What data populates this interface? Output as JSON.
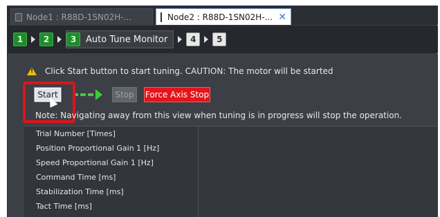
{
  "tabs": [
    {
      "label": "Node1 : R88D-1SN02H-...",
      "active": false
    },
    {
      "label": "Node2 : R88D-1SN02H-...",
      "active": true
    }
  ],
  "tab_close_glyph": "✕",
  "steps": {
    "items": [
      "1",
      "2",
      "3",
      "4",
      "5"
    ],
    "current_label": "Auto Tune Monitor",
    "done_color": "#1f8c2c"
  },
  "warning": {
    "icon": "warning-triangle-icon",
    "text": "Click Start button to start tuning. CAUTION: The motor will be started"
  },
  "buttons": {
    "start": "Start",
    "stop": "Stop",
    "force_stop": "Force Axis Stop",
    "force_stop_color": "#e4141a"
  },
  "note": "Note: Navigating away from this view when tuning is in progress will stop the operation.",
  "parameters": [
    "Trial Number [Times]",
    "Position Proportional Gain 1 [Hz]",
    "Speed Proportional Gain 1 [Hz]",
    "Command Time [ms]",
    "Stabilization Time [ms]",
    "Tact Time [ms]"
  ]
}
